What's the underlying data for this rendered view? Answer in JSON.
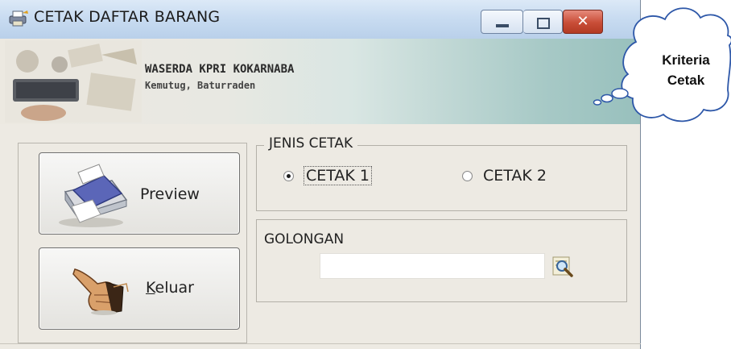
{
  "window": {
    "title": "CETAK DAFTAR BARANG",
    "controls": {
      "minimize": "minimize",
      "maximize": "maximize",
      "close": "✕"
    }
  },
  "banner": {
    "company": "WASERDA KPRI KOKARNABA",
    "address": "Kemutug, Baturraden"
  },
  "actions": {
    "preview_label": "Preview",
    "keluar_rest": "eluar",
    "keluar_mnemonic": "K"
  },
  "jenis_cetak": {
    "legend": "JENIS CETAK",
    "options": [
      {
        "label": "CETAK 1",
        "checked": true
      },
      {
        "label": "CETAK 2",
        "checked": false
      }
    ]
  },
  "golongan": {
    "label": "GOLONGAN",
    "value": "",
    "placeholder": ""
  },
  "callout": {
    "line1": "Kriteria",
    "line2": "Cetak"
  },
  "icons": [
    "app-icon",
    "printer-icon",
    "pointing-hand-icon",
    "magnifier-icon"
  ],
  "colors": {
    "close_button": "#c84d37",
    "titlebar": "#c9dcf1",
    "window_bg": "#edeae3",
    "banner_accent": "#98c0bd"
  }
}
